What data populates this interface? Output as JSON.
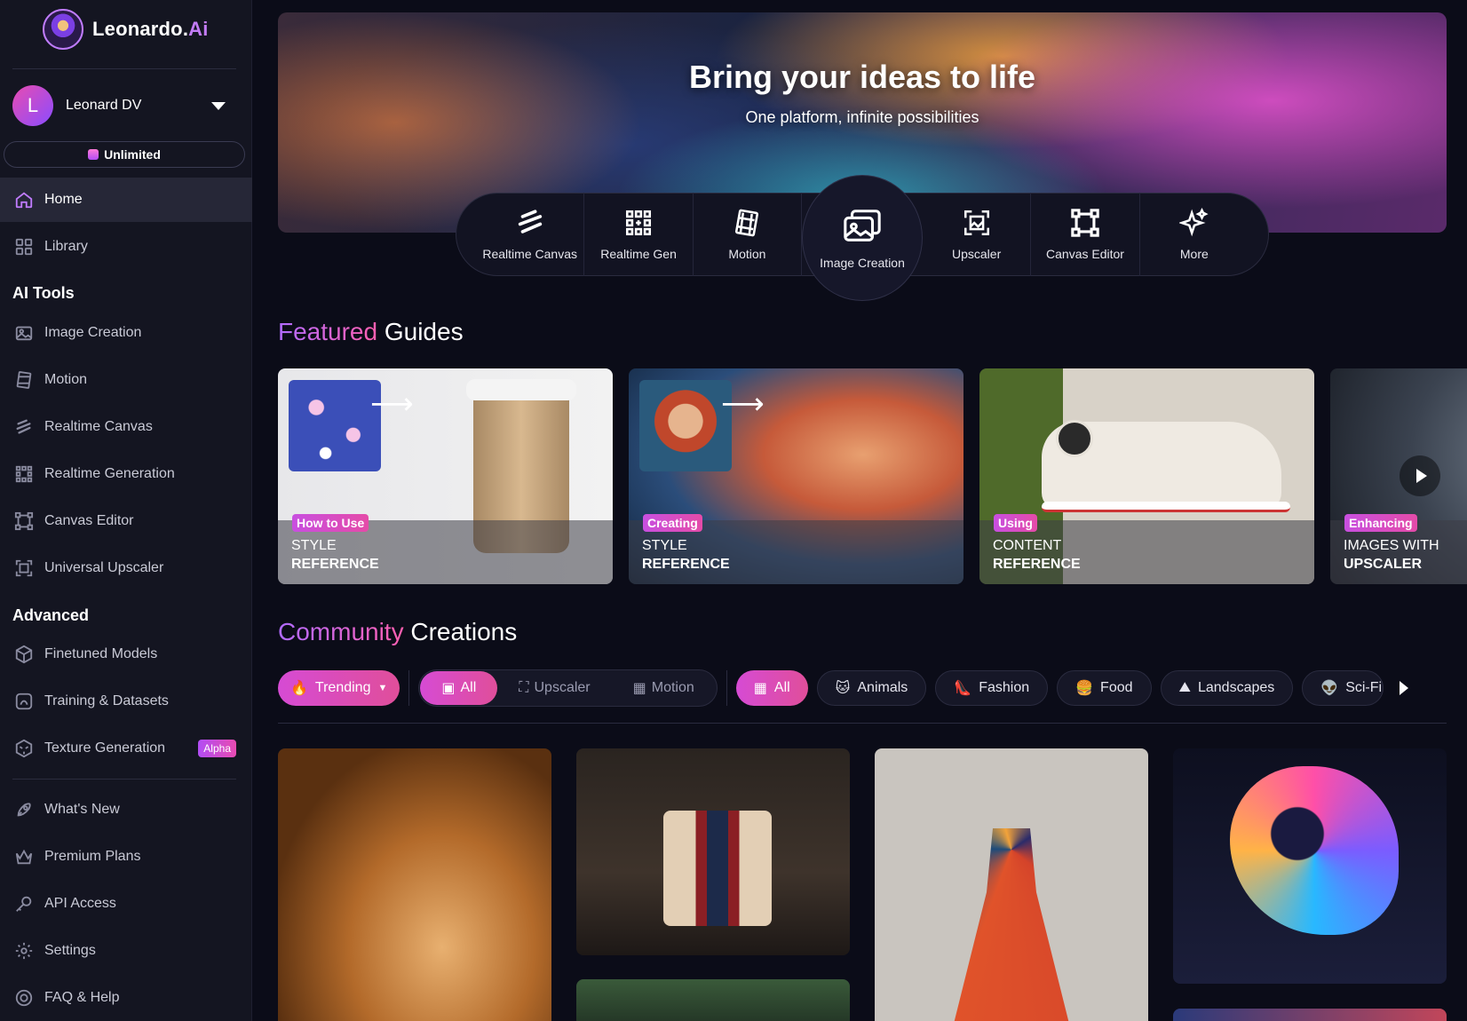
{
  "brand": {
    "name": "Leonardo.",
    "name_suffix": "Ai"
  },
  "user": {
    "initial": "L",
    "name": "Leonard DV"
  },
  "plan": {
    "label": "Unlimited"
  },
  "sidebar": {
    "primary": [
      {
        "label": "Home",
        "icon": "home-icon",
        "active": true
      },
      {
        "label": "Library",
        "icon": "grid-icon"
      }
    ],
    "ai_tools_title": "AI Tools",
    "ai_tools": [
      {
        "label": "Image Creation",
        "icon": "image-icon"
      },
      {
        "label": "Motion",
        "icon": "film-icon"
      },
      {
        "label": "Realtime Canvas",
        "icon": "scribble-icon"
      },
      {
        "label": "Realtime Generation",
        "icon": "dots-grid-icon"
      },
      {
        "label": "Canvas Editor",
        "icon": "crop-square-icon"
      },
      {
        "label": "Universal Upscaler",
        "icon": "upscale-icon"
      }
    ],
    "advanced_title": "Advanced",
    "advanced": [
      {
        "label": "Finetuned Models",
        "icon": "cube-icon"
      },
      {
        "label": "Training & Datasets",
        "icon": "training-icon"
      },
      {
        "label": "Texture Generation",
        "icon": "texture-cube-icon",
        "badge": "Alpha"
      }
    ],
    "footer": [
      {
        "label": "What's New",
        "icon": "rocket-icon"
      },
      {
        "label": "Premium Plans",
        "icon": "crown-icon"
      },
      {
        "label": "API Access",
        "icon": "key-icon"
      },
      {
        "label": "Settings",
        "icon": "gear-icon"
      },
      {
        "label": "FAQ & Help",
        "icon": "help-icon"
      }
    ]
  },
  "hero": {
    "title": "Bring your ideas to life",
    "subtitle": "One platform, infinite possibilities"
  },
  "tools": [
    {
      "label": "Realtime Canvas",
      "icon": "scribble-icon"
    },
    {
      "label": "Realtime Gen",
      "icon": "dots-grid-icon"
    },
    {
      "label": "Motion",
      "icon": "film-icon"
    },
    {
      "label": "Image Creation",
      "icon": "image-icon",
      "featured": true
    },
    {
      "label": "Upscaler",
      "icon": "upscale-icon"
    },
    {
      "label": "Canvas Editor",
      "icon": "crop-square-icon"
    },
    {
      "label": "More",
      "icon": "sparkles-icon"
    }
  ],
  "featured": {
    "title_accent": "Featured",
    "title_rest": "Guides",
    "guides": [
      {
        "tag": "How to Use",
        "line1": "STYLE",
        "line2": "REFERENCE"
      },
      {
        "tag": "Creating",
        "line1": "STYLE",
        "line2": "REFERENCE"
      },
      {
        "tag": "Using",
        "line1": "CONTENT",
        "line2": "REFERENCE"
      },
      {
        "tag": "Enhancing",
        "line1": "IMAGES WITH",
        "line2": "UPSCALER"
      }
    ]
  },
  "community": {
    "title_accent": "Community",
    "title_rest": "Creations",
    "sort": "Trending",
    "type_filters": [
      "All",
      "Upscaler",
      "Motion"
    ],
    "categories": [
      "All",
      "Animals",
      "Fashion",
      "Food",
      "Landscapes",
      "Sci-Fi"
    ]
  },
  "colors": {
    "accent_start": "#b06bff",
    "accent_end": "#ff5fb0",
    "sidebar_bg": "#141521",
    "page_bg": "#0b0c18"
  }
}
